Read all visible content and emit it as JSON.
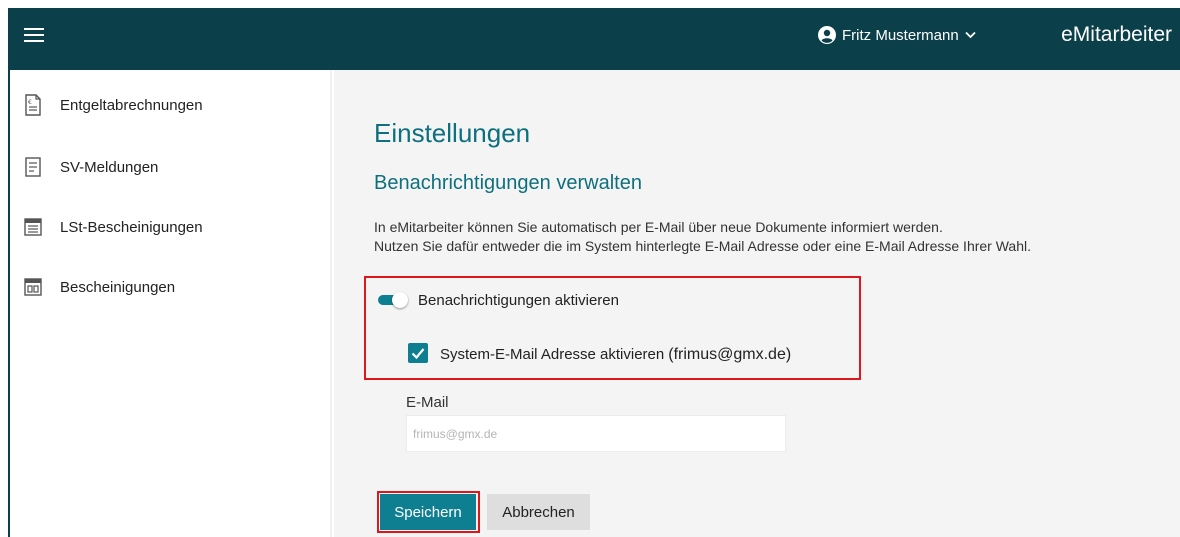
{
  "header": {
    "menu_icon": "hamburger-icon",
    "user_icon": "user-circle-icon",
    "user_name": "Fritz Mustermann",
    "brand": "eMitarbeiter",
    "background": "#0b3f4a"
  },
  "sidebar": {
    "items": [
      {
        "label": "Entgeltabrechnungen",
        "icon": "payslip-icon"
      },
      {
        "label": "SV-Meldungen",
        "icon": "document-list-icon"
      },
      {
        "label": "LSt-Bescheinigungen",
        "icon": "table-document-icon"
      },
      {
        "label": "Bescheinigungen",
        "icon": "certificate-icon"
      }
    ]
  },
  "main": {
    "title": "Einstellungen",
    "subtitle": "Benachrichtigungen verwalten",
    "description_line1": "In eMitarbeiter können Sie automatisch per E-Mail über neue Dokumente informiert werden.",
    "description_line2": "Nutzen Sie dafür entweder die im System hinterlegte E-Mail Adresse oder eine E-Mail Adresse Ihrer Wahl.",
    "toggle_label": "Benachrichtigungen aktivieren",
    "toggle_on": true,
    "checkbox_label": "System-E-Mail Adresse aktivieren",
    "checkbox_email": "(frimus@gmx.de)",
    "checkbox_checked": true,
    "email_label": "E-Mail",
    "email_placeholder": "frimus@gmx.de",
    "save_label": "Speichern",
    "cancel_label": "Abbrechen"
  },
  "colors": {
    "accent": "#0e7f91",
    "heading": "#0e6f7e",
    "highlight": "#e0161d"
  }
}
